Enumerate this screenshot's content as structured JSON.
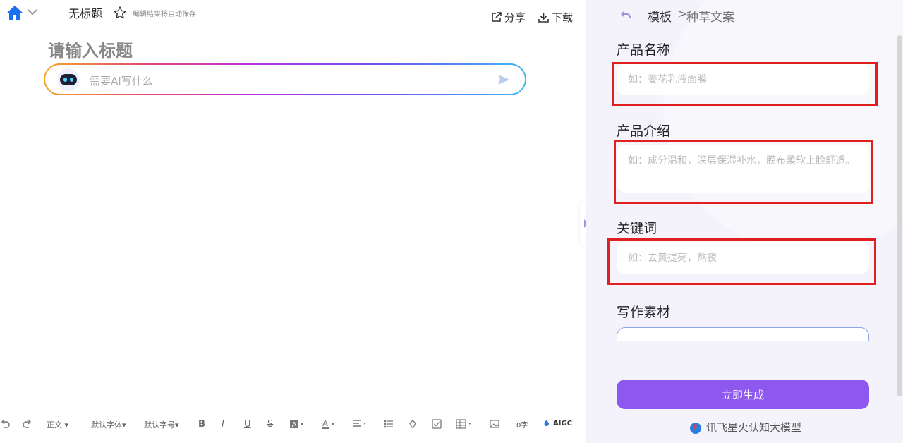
{
  "header": {
    "doc_title": "无标题",
    "autosave_note": "编辑结果将自动保存",
    "share_label": "分享",
    "download_label": "下载"
  },
  "editor": {
    "title_placeholder": "请输入标题",
    "ai_placeholder": "需要AI写什么"
  },
  "toolbar": {
    "paragraph_style": "正文",
    "font_family": "默认字体",
    "font_size": "默认字号",
    "word_count": "0字",
    "aigc_label": "AIGC"
  },
  "panel": {
    "breadcrumb_root": "模板",
    "breadcrumb_sep": ">",
    "breadcrumb_current": "种草文案",
    "fields": [
      {
        "label": "产品名称",
        "placeholder": "如：姜花乳液面膜"
      },
      {
        "label": "产品介绍",
        "placeholder": "如：成分温和，深层保湿补水，膜布柔软上脸舒适。"
      },
      {
        "label": "关键词",
        "placeholder": "如：去黄提亮，熬夜"
      },
      {
        "label": "写作素材",
        "placeholder": ""
      }
    ],
    "generate_label": "立即生成",
    "brand_label": "讯飞星火认知大模型"
  },
  "colors": {
    "accent_purple": "#8e58f0",
    "home_blue": "#1a6ff0",
    "highlight_red": "#e02020"
  }
}
